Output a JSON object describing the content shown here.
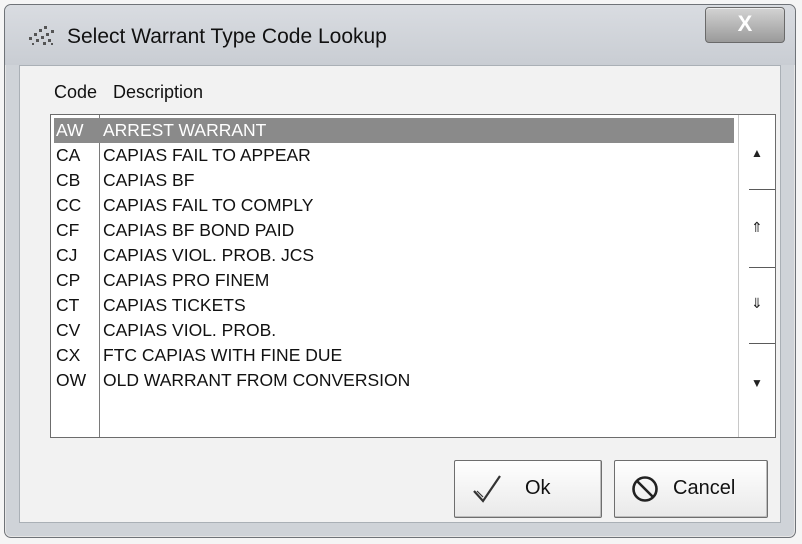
{
  "window": {
    "title": "Select Warrant Type Code Lookup",
    "close_label": "X"
  },
  "columns": {
    "code": "Code",
    "description": "Description"
  },
  "rows": [
    {
      "code": "AW",
      "description": "ARREST WARRANT",
      "selected": true
    },
    {
      "code": "CA",
      "description": "CAPIAS FAIL TO APPEAR"
    },
    {
      "code": "CB",
      "description": "CAPIAS BF"
    },
    {
      "code": "CC",
      "description": "CAPIAS FAIL TO COMPLY"
    },
    {
      "code": "CF",
      "description": "CAPIAS BF BOND PAID"
    },
    {
      "code": "CJ",
      "description": "CAPIAS VIOL. PROB. JCS"
    },
    {
      "code": "CP",
      "description": "CAPIAS PRO FINEM"
    },
    {
      "code": "CT",
      "description": "CAPIAS TICKETS"
    },
    {
      "code": "CV",
      "description": "CAPIAS VIOL. PROB."
    },
    {
      "code": "CX",
      "description": "FTC CAPIAS WITH FINE DUE"
    },
    {
      "code": "OW",
      "description": "OLD WARRANT FROM CONVERSION"
    }
  ],
  "buttons": {
    "ok_label": "Ok",
    "cancel_label": "Cancel"
  },
  "icons": {
    "app": "pattern-icon",
    "ok": "checkmark-icon",
    "cancel": "no-sign-icon"
  },
  "colors": {
    "selected_row_bg": "#8a8a8a",
    "selected_row_text": "#ffffff"
  }
}
